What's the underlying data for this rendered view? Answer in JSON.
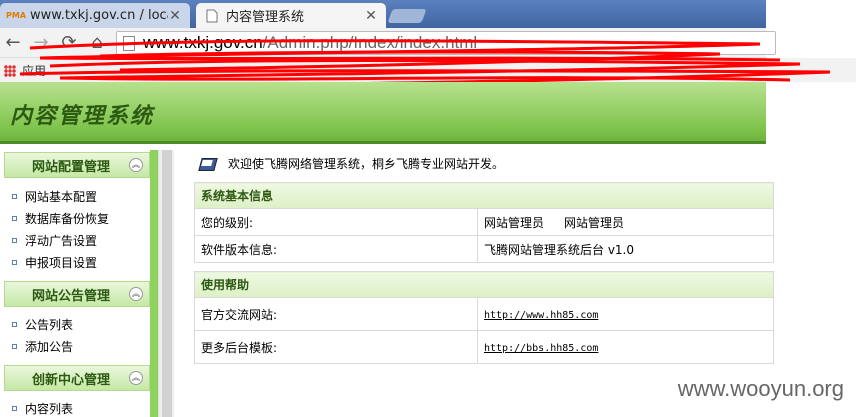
{
  "browser": {
    "tabs": [
      {
        "title": "www.txkj.gov.cn / localh",
        "favicon": "PMA"
      },
      {
        "title": "内容管理系统"
      }
    ],
    "url_host": "www.txkj.gov.cn",
    "url_path": "/Admin.php/Index/index.html",
    "bookmarks_apps_label": "应用"
  },
  "app": {
    "title": "内容管理系统"
  },
  "sidebar": {
    "sections": [
      {
        "label": "网站配置管理",
        "items": [
          "网站基本配置",
          "数据库备份恢复",
          "浮动广告设置",
          "申报项目设置"
        ]
      },
      {
        "label": "网站公告管理",
        "items": [
          "公告列表",
          "添加公告"
        ]
      },
      {
        "label": "创新中心管理",
        "items": [
          "内容列表"
        ]
      }
    ]
  },
  "main": {
    "welcome": "欢迎使飞腾网络管理系统，桐乡飞腾专业网站开发。",
    "system_info": {
      "header": "系统基本信息",
      "level_label": "您的级别:",
      "level_value_1": "网站管理员",
      "level_value_2": "网站管理员",
      "version_label": "软件版本信息:",
      "version_value": "飞腾网站管理系统后台 v1.0"
    },
    "help": {
      "header": "使用帮助",
      "site_label": "官方交流网站:",
      "site_value": "http://www.hh85.com",
      "templates_label": "更多后台模板:",
      "templates_value": "http://bbs.hh85.com"
    }
  },
  "watermark": "www.wooyun.org",
  "colors": {
    "header_green": "#7ec34b",
    "title_green": "#2d5a12",
    "redaction_red": "#ff0000"
  }
}
